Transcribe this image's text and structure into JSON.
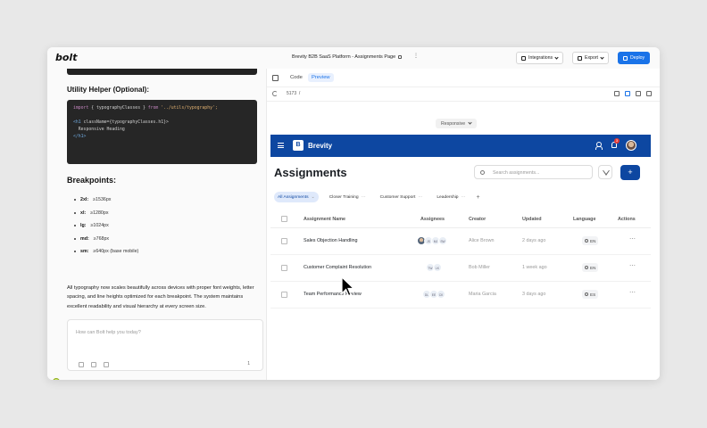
{
  "window": {
    "logo": "bolt",
    "project_title": "Brevity B2B SaaS Platform - Assignments Page",
    "project_menu": "⋮",
    "integrations_label": "Integrations",
    "export_label": "Export",
    "deploy_label": "Deploy"
  },
  "left": {
    "utility_heading": "Utility Helper (Optional):",
    "code": {
      "line1_kw": "import",
      "line1_mid": " { typographyClasses } ",
      "line1_from": "from",
      "line1_str": " '../utils/typography';",
      "line2_tag": "<h1 ",
      "line2_attr": "className={typographyClasses.h1}>",
      "line3": "  Responsive Heading",
      "line4_tag": "</h1>"
    },
    "breakpoints_heading": "Breakpoints:",
    "breakpoints": [
      {
        "key": "2xl:",
        "value": "≥1536px"
      },
      {
        "key": "xl:",
        "value": "≥1280px"
      },
      {
        "key": "lg:",
        "value": "≥1024px"
      },
      {
        "key": "md:",
        "value": "≥768px"
      },
      {
        "key": "sm:",
        "value": "≥640px (base mobile)"
      }
    ],
    "paragraph": "All typography now scales beautifully across devices with proper font weights, letter spacing, and line heights optimized for each breakpoint. The system maintains excellent readability and visual hierarchy at every screen size.",
    "chat_placeholder": "How can Bolt help you today?",
    "chat_count": "1"
  },
  "preview": {
    "tab_code": "Code",
    "tab_preview": "Preview",
    "url_port": "5173",
    "url_path": "/",
    "responsive_label": "Responsive"
  },
  "app": {
    "brand_mark": "B",
    "brand": "Brevity",
    "notif_count": "3",
    "title": "Assignments",
    "search_placeholder": "Search assignments...",
    "add_label": "+",
    "chips": [
      {
        "label": "All Assignments",
        "active": true
      },
      {
        "label": "Closer Training",
        "active": false
      },
      {
        "label": "Customer Support",
        "active": false
      },
      {
        "label": "Leadership",
        "active": false
      }
    ],
    "chip_add": "+",
    "columns": [
      "Assignment Name",
      "Assignees",
      "Creator",
      "Updated",
      "Language",
      "Actions"
    ],
    "rows": [
      {
        "name": "Sales Objection Handling",
        "assignees": [
          "",
          "JS",
          "MJ",
          "SW"
        ],
        "creator": "Alice Brown",
        "updated": "2 days ago",
        "language": "EN",
        "actions": "⋯"
      },
      {
        "name": "Customer Complaint Resolution",
        "assignees": [
          "TW",
          "LK"
        ],
        "creator": "Bob Miller",
        "updated": "1 week ago",
        "language": "EN",
        "actions": "⋯"
      },
      {
        "name": "Team Performance Review",
        "assignees": [
          "DL",
          "EE",
          "CK"
        ],
        "creator": "Maria Garcia",
        "updated": "3 days ago",
        "language": "ES",
        "actions": "⋯"
      }
    ]
  }
}
